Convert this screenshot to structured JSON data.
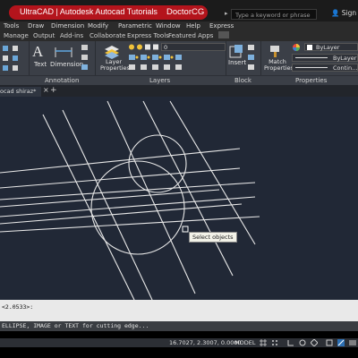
{
  "title_bar": {
    "banner_left": "UltraCAD | Autodesk Autocad Tutorials",
    "banner_right": "DoctorCG",
    "search_placeholder": "Type a keyword or phrase",
    "user_label": "Sign In"
  },
  "menu_bar": {
    "items": [
      "Tools",
      "Draw",
      "Dimension",
      "Modify",
      "Parametric",
      "Window",
      "Help",
      "Express"
    ]
  },
  "ribbon_tabs": {
    "items": [
      "Manage",
      "Output",
      "Add-ins",
      "Collaborate",
      "Express Tools",
      "Featured Apps"
    ]
  },
  "ribbon": {
    "text_label": "Text",
    "dimension_label": "Dimension",
    "layer_properties_label": "Layer Properties",
    "layer_value": "0",
    "insert_label": "Insert",
    "match_properties_label": "Match Properties",
    "bylayer_color": "ByLayer",
    "bylayer_linetype": "ByLayer",
    "continuous_label": "Contin...",
    "panels": [
      "Annotation",
      "Layers",
      "Block",
      "Properties"
    ]
  },
  "document_tab": {
    "label": "ocad shiraz*"
  },
  "drawing": {
    "tooltip": "Select objects"
  },
  "command": {
    "history_line": "<2.0533>:",
    "current_line": "ELLIPSE, IMAGE or TEXT for cutting edge..."
  },
  "status_bar": {
    "coordinates": "16.7027, 2.3007, 0.0000",
    "model_label": "MODEL"
  },
  "colors": {
    "banner": "#b4141c",
    "canvas_bg": "#212836",
    "ribbon_bg": "#3b3f47",
    "geometry": "#e8e8e8"
  }
}
